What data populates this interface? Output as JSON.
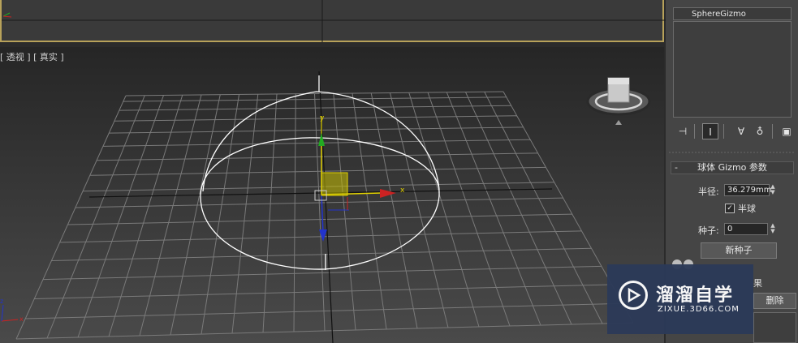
{
  "viewport": {
    "label": "[ 透视 ] [ 真实 ]",
    "axis_x": "x",
    "axis_y": "y",
    "corner_x": "x",
    "corner_z": "z"
  },
  "command_panel": {
    "object_name": "SphereGizmo",
    "toolbar": [
      "pin-stack-icon",
      "show-end-result-icon",
      "make-unique-icon",
      "remove-modifier-icon",
      "configure-sets-icon"
    ],
    "rollout": {
      "title": "球体 Gizmo 参数",
      "radius_label": "半径:",
      "radius_value": "36.279mm",
      "hemisphere_label": "半球",
      "hemisphere_checked": true,
      "seed_label": "种子:",
      "seed_value": "0",
      "new_seed_label": "新种子"
    },
    "effects": {
      "partial_label": "果",
      "delete_label": "删除"
    }
  },
  "watermark": {
    "title": "溜溜自学",
    "url": "ZIXUE.3D66.COM"
  },
  "colors": {
    "gizmo": "#ffffff",
    "x_axis": "#cc2222",
    "y_axis": "#22aa22",
    "z_axis": "#2233cc",
    "selection_yellow": "#d4d400",
    "watermark_bg": "#2c3a58"
  }
}
